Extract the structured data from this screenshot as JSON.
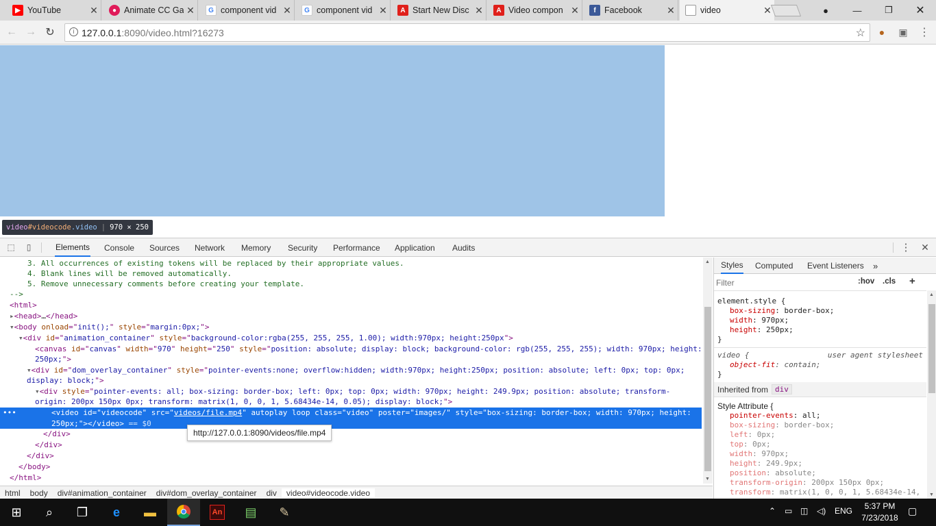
{
  "browser": {
    "tabs": [
      {
        "title": "YouTube",
        "icon": "youtube-icon",
        "color": "#ff0000"
      },
      {
        "title": "Animate CC Ga",
        "icon": "animate-icon",
        "color": "#e01b5a"
      },
      {
        "title": "component vid",
        "icon": "google-icon",
        "color": "#4285f4"
      },
      {
        "title": "component vid",
        "icon": "google-icon",
        "color": "#4285f4"
      },
      {
        "title": "Start New Disc",
        "icon": "adobe-icon",
        "color": "#e0201b"
      },
      {
        "title": "Video compon",
        "icon": "adobe-icon",
        "color": "#e0201b"
      },
      {
        "title": "Facebook",
        "icon": "facebook-icon",
        "color": "#3b5998"
      },
      {
        "title": "video",
        "icon": "page-icon",
        "color": "#888888"
      }
    ],
    "url_host": "127.0.0.1",
    "url_rest": ":8090/video.html?16273"
  },
  "viewport": {
    "video_color": "#9fc4e7",
    "tooltip": {
      "tag": "video",
      "id": "#videocode",
      "cls": ".video",
      "size": "970 × 250"
    }
  },
  "devtools": {
    "tabs": [
      "Elements",
      "Console",
      "Sources",
      "Network",
      "Memory",
      "Security",
      "Performance",
      "Application",
      "Audits"
    ],
    "link_tooltip": "http://127.0.0.1:8090/videos/file.mp4",
    "breadcrumbs": [
      "html",
      "body",
      "div#animation_container",
      "div#dom_overlay_container",
      "div",
      "video#videocode.video"
    ],
    "styles": {
      "tabs": [
        "Styles",
        "Computed",
        "Event Listeners"
      ],
      "filter_placeholder": "Filter",
      "hov": ":hov",
      "cls": ".cls",
      "element_style_selector": "element.style {",
      "element_style": [
        {
          "name": "box-sizing",
          "value": "border-box;"
        },
        {
          "name": "width",
          "value": "970px;"
        },
        {
          "name": "height",
          "value": "250px;"
        }
      ],
      "ua_selector": "video {",
      "ua_source": "user agent stylesheet",
      "ua_prop": {
        "name": "object-fit",
        "value": "contain;"
      },
      "inherited_label": "Inherited from",
      "inherited_from": "div",
      "attr_selector": "Style Attribute {",
      "attr_props": [
        {
          "name": "pointer-events",
          "value": "all;"
        },
        {
          "name": "box-sizing",
          "value": "border-box;"
        },
        {
          "name": "left",
          "value": "0px;"
        },
        {
          "name": "top",
          "value": "0px;"
        },
        {
          "name": "width",
          "value": "970px;"
        },
        {
          "name": "height",
          "value": "249.9px;"
        },
        {
          "name": "position",
          "value": "absolute;"
        },
        {
          "name": "transform-origin",
          "value": "200px 150px 0px;"
        },
        {
          "name": "transform",
          "value": "matrix(1, 0, 0, 1, 5.68434e-14,"
        }
      ]
    }
  },
  "taskbar": {
    "time": "5:37 PM",
    "date": "7/23/2018",
    "lang": "ENG"
  }
}
